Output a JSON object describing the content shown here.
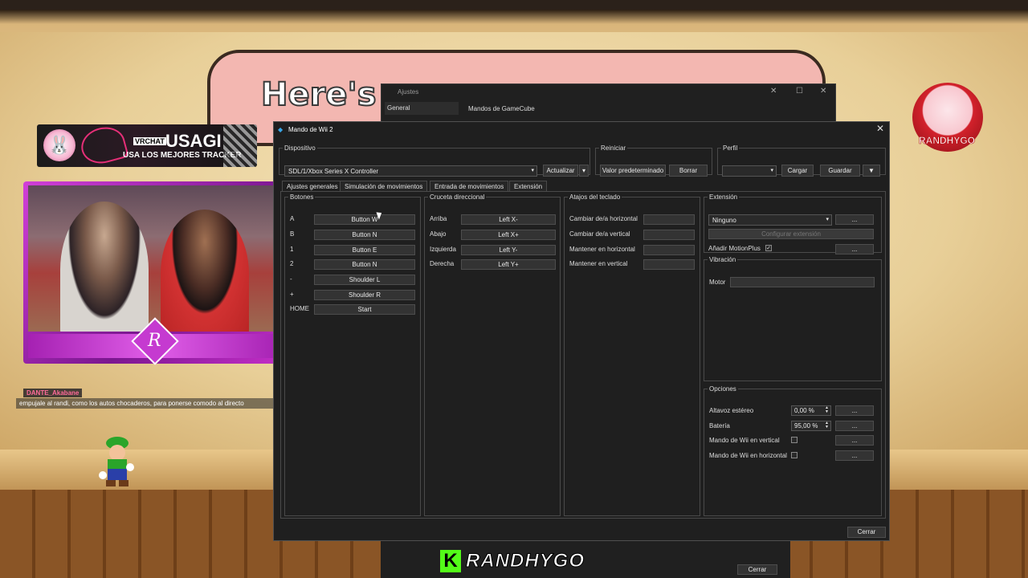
{
  "background": {
    "heading_text": "Here's",
    "banner": {
      "tag": "VRCHAT",
      "name": "USAGI",
      "subtitle": "USA LOS MEJORES TRACKER"
    },
    "chat": {
      "username": "DANTE_Akabane",
      "message": "empujale al randi, como los autos chocaderos, para ponerse comodo al directo"
    },
    "avatar_logo_text": "RANDHYGO",
    "footer_brand": "RANDHYGO",
    "cam_emblem_letter": "R"
  },
  "settings_window": {
    "title": "Ajustes",
    "nav_item": "General",
    "group_label": "Mandos de GameCube",
    "close_button": "Cerrar"
  },
  "dialog": {
    "title": "Mando de Wii 2",
    "device": {
      "label": "Dispositivo",
      "selected": "SDL/1/Xbox Series X Controller",
      "refresh_button": "Actualizar"
    },
    "reset": {
      "label": "Reiniciar",
      "default_button": "Valor predeterminado",
      "clear_button": "Borrar"
    },
    "profile": {
      "label": "Perfil",
      "selected": "",
      "load_button": "Cargar",
      "save_button": "Guardar"
    },
    "tabs": [
      "Ajustes generales",
      "Simulación de movimientos",
      "Entrada de movimientos",
      "Extensión"
    ],
    "buttons_group": {
      "label": "Botones",
      "rows": [
        {
          "name": "A",
          "binding": "Button W"
        },
        {
          "name": "B",
          "binding": "Button N"
        },
        {
          "name": "1",
          "binding": "Button E"
        },
        {
          "name": "2",
          "binding": "Button N"
        },
        {
          "name": "-",
          "binding": "Shoulder L"
        },
        {
          "name": "+",
          "binding": "Shoulder R"
        },
        {
          "name": "HOME",
          "binding": "Start"
        }
      ]
    },
    "dpad_group": {
      "label": "Cruceta direccional",
      "rows": [
        {
          "name": "Arriba",
          "binding": "Left X-"
        },
        {
          "name": "Abajo",
          "binding": "Left X+"
        },
        {
          "name": "Izquierda",
          "binding": "Left Y-"
        },
        {
          "name": "Derecha",
          "binding": "Left Y+"
        }
      ]
    },
    "hotkeys_group": {
      "label": "Atajos del teclado",
      "rows": [
        {
          "name": "Cambiar de/a horizontal",
          "binding": ""
        },
        {
          "name": "Cambiar de/a vertical",
          "binding": ""
        },
        {
          "name": "Mantener en horizontal",
          "binding": ""
        },
        {
          "name": "Mantener en vertical",
          "binding": ""
        }
      ]
    },
    "extension_group": {
      "label": "Extensión",
      "selected": "Ninguno",
      "more_button": "...",
      "configure_button": "Configurar extensión",
      "motionplus_label": "Añadir MotionPlus",
      "motionplus_checked": "✓"
    },
    "vibration_group": {
      "label": "Vibración",
      "motor_label": "Motor",
      "motor_binding": ""
    },
    "options_group": {
      "label": "Opciones",
      "speaker_label": "Altavoz estéreo",
      "speaker_value": "0,00 %",
      "battery_label": "Batería",
      "battery_value": "95,00 %",
      "upright_label": "Mando de Wii en vertical",
      "sideways_label": "Mando de Wii en horizontal",
      "more_button": "..."
    },
    "close_button": "Cerrar"
  },
  "colors": {
    "dialog_bg": "#1f1f1f",
    "accent": "#3aa7e8",
    "kick_green": "#53fc18",
    "cam_frame": "#c52ec9"
  }
}
